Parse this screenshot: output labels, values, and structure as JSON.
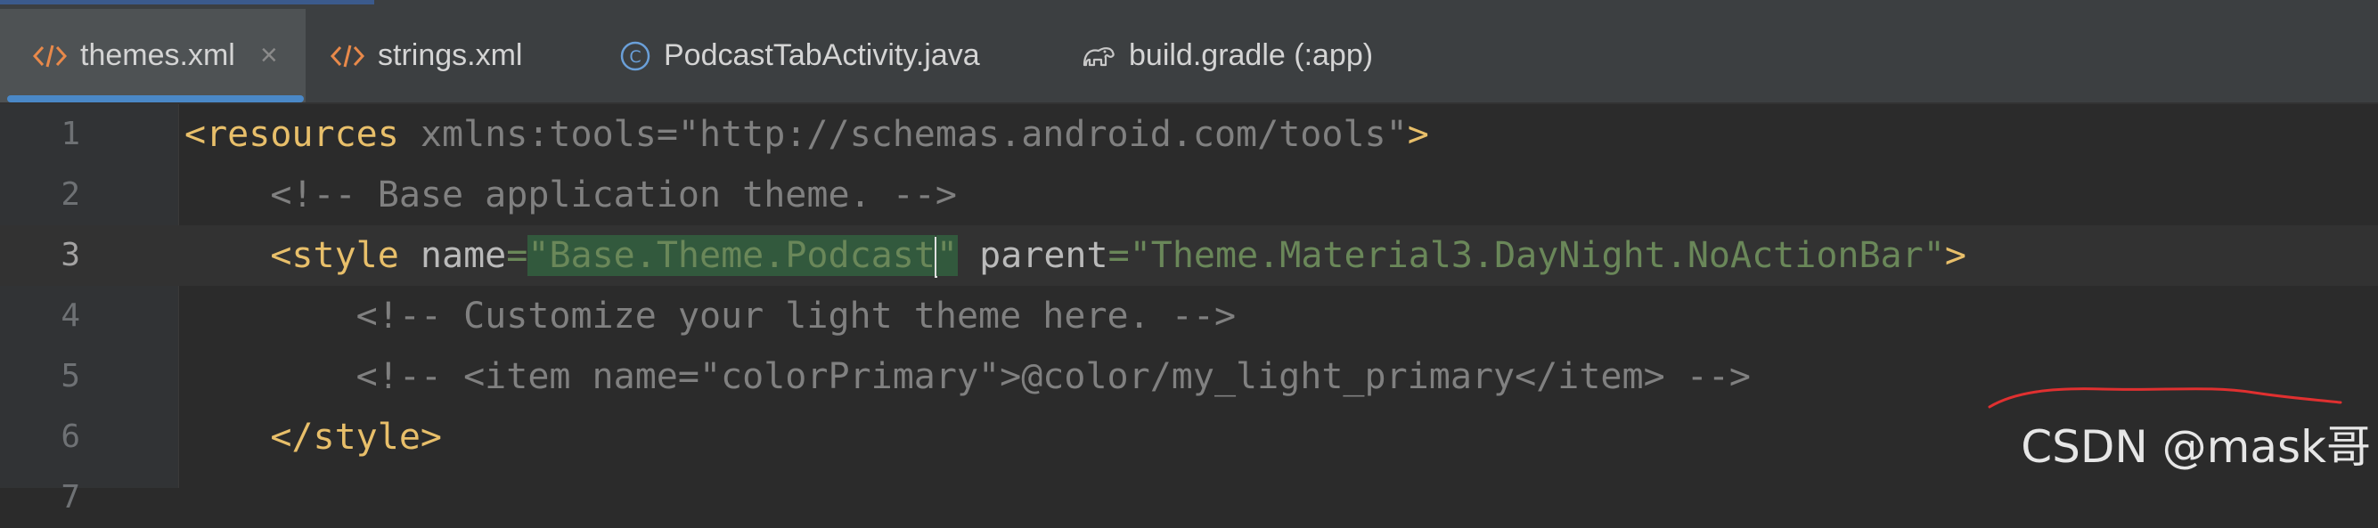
{
  "tabs": [
    {
      "label": "themes.xml",
      "icon": "xml-file-icon",
      "active": true,
      "closable": true
    },
    {
      "label": "strings.xml",
      "icon": "xml-file-icon",
      "active": false
    },
    {
      "label": "PodcastTabActivity.java",
      "icon": "java-class-icon",
      "active": false
    },
    {
      "label": "build.gradle (:app)",
      "icon": "gradle-icon",
      "active": false
    }
  ],
  "close_glyph": "×",
  "line_numbers": [
    "1",
    "2",
    "3",
    "4",
    "5",
    "6",
    "7"
  ],
  "code": {
    "l1": {
      "open": "<resources",
      "ns_attr": " xmlns:tools=",
      "ns_val": "\"http://schemas.android.com/tools\"",
      "close": ">"
    },
    "l2": {
      "comment": "<!-- Base application theme. -->"
    },
    "l3": {
      "open": "<style",
      "attr1": " name",
      "eq1": "=",
      "q_open": "\"",
      "name_value": "Base.Theme.Podcast",
      "q_close": "\"",
      "attr2": " parent",
      "eq2": "=",
      "parent_value": "\"Theme.Material3.DayNight.NoActionBar\"",
      "close": ">"
    },
    "l4": {
      "comment": "<!-- Customize your light theme here. -->"
    },
    "l5": {
      "comment": "<!-- <item name=\"colorPrimary\">@color/my_light_primary</item> -->"
    },
    "l6": {
      "close_tag": "</style>"
    }
  },
  "colors": {
    "tag": "#e8bf6a",
    "string": "#6a8759",
    "comment": "#808080",
    "annotation": "#e03030",
    "active_tab_indicator": "#4a88c7"
  },
  "watermark": "CSDN @mask哥"
}
